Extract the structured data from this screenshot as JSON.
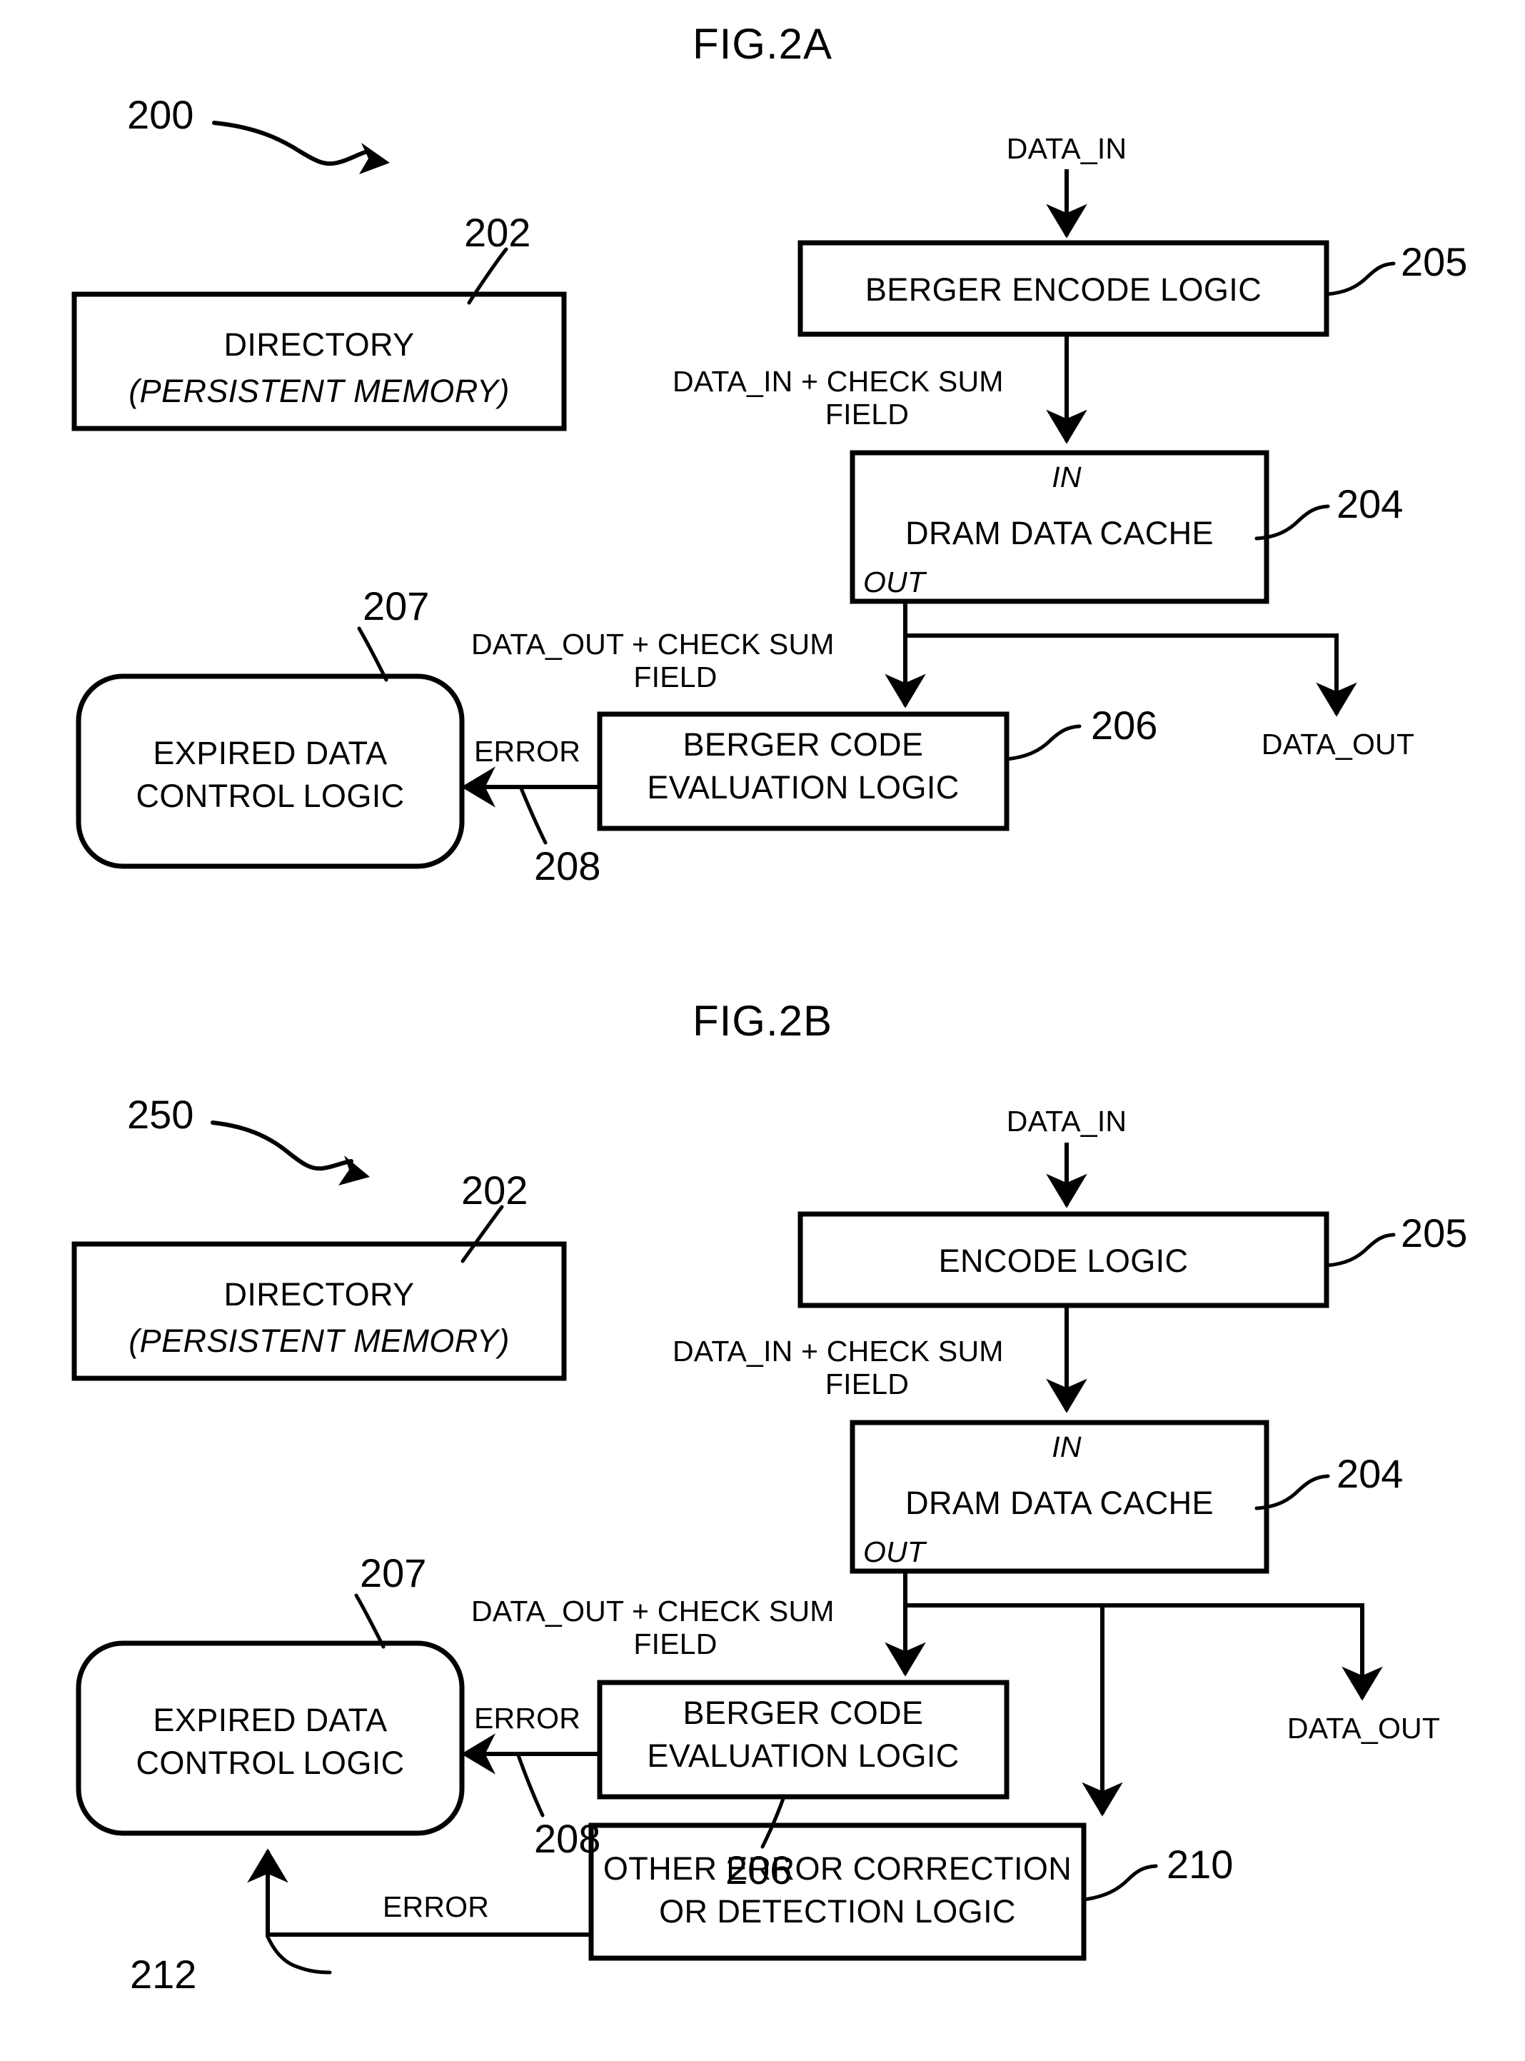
{
  "sheet": {
    "background": "#ffffff",
    "ink": "#000000"
  },
  "figures": [
    {
      "id": "fig-2a",
      "title": "FIG.2A",
      "system_ref": "200",
      "blocks": [
        {
          "key": "directory",
          "ref": "202",
          "line1": "DIRECTORY",
          "line2": "(PERSISTENT MEMORY)",
          "shape": "rect"
        },
        {
          "key": "encode",
          "ref": "205",
          "line1": "BERGER ENCODE LOGIC",
          "shape": "rect"
        },
        {
          "key": "cache",
          "ref": "204",
          "line1": "DRAM DATA CACHE",
          "port_in": "IN",
          "port_out": "OUT",
          "shape": "rect"
        },
        {
          "key": "evaluation",
          "ref": "206",
          "line1": "BERGER CODE",
          "line2": "EVALUATION LOGIC",
          "shape": "rect"
        },
        {
          "key": "expired",
          "ref": "207",
          "line1": "EXPIRED DATA",
          "line2": "CONTROL LOGIC",
          "shape": "rounded"
        }
      ],
      "signals": {
        "data_in": "DATA_IN",
        "data_in_checksum_l1": "DATA_IN + CHECK SUM",
        "data_in_checksum_l2": "FIELD",
        "data_out_checksum_l1": "DATA_OUT + CHECK SUM",
        "data_out_checksum_l2": "FIELD",
        "data_out": "DATA_OUT",
        "error": "ERROR",
        "error_ref": "208"
      }
    },
    {
      "id": "fig-2b",
      "title": "FIG.2B",
      "system_ref": "250",
      "blocks": [
        {
          "key": "directory",
          "ref": "202",
          "line1": "DIRECTORY",
          "line2": "(PERSISTENT MEMORY)",
          "shape": "rect"
        },
        {
          "key": "encode",
          "ref": "205",
          "line1": "ENCODE LOGIC",
          "shape": "rect"
        },
        {
          "key": "cache",
          "ref": "204",
          "line1": "DRAM DATA CACHE",
          "port_in": "IN",
          "port_out": "OUT",
          "shape": "rect"
        },
        {
          "key": "evaluation",
          "ref": "206",
          "line1": "BERGER CODE",
          "line2": "EVALUATION LOGIC",
          "shape": "rect"
        },
        {
          "key": "expired",
          "ref": "207",
          "line1": "EXPIRED DATA",
          "line2": "CONTROL LOGIC",
          "shape": "rounded"
        },
        {
          "key": "other_ecc",
          "ref": "210",
          "line1": "OTHER ERROR CORRECTION",
          "line2": "OR DETECTION LOGIC",
          "shape": "rect"
        }
      ],
      "signals": {
        "data_in": "DATA_IN",
        "data_in_checksum_l1": "DATA_IN + CHECK SUM",
        "data_in_checksum_l2": "FIELD",
        "data_out_checksum_l1": "DATA_OUT + CHECK SUM",
        "data_out_checksum_l2": "FIELD",
        "data_out": "DATA_OUT",
        "error": "ERROR",
        "error_ref": "208",
        "error2": "ERROR",
        "error2_ref": "212"
      }
    }
  ]
}
